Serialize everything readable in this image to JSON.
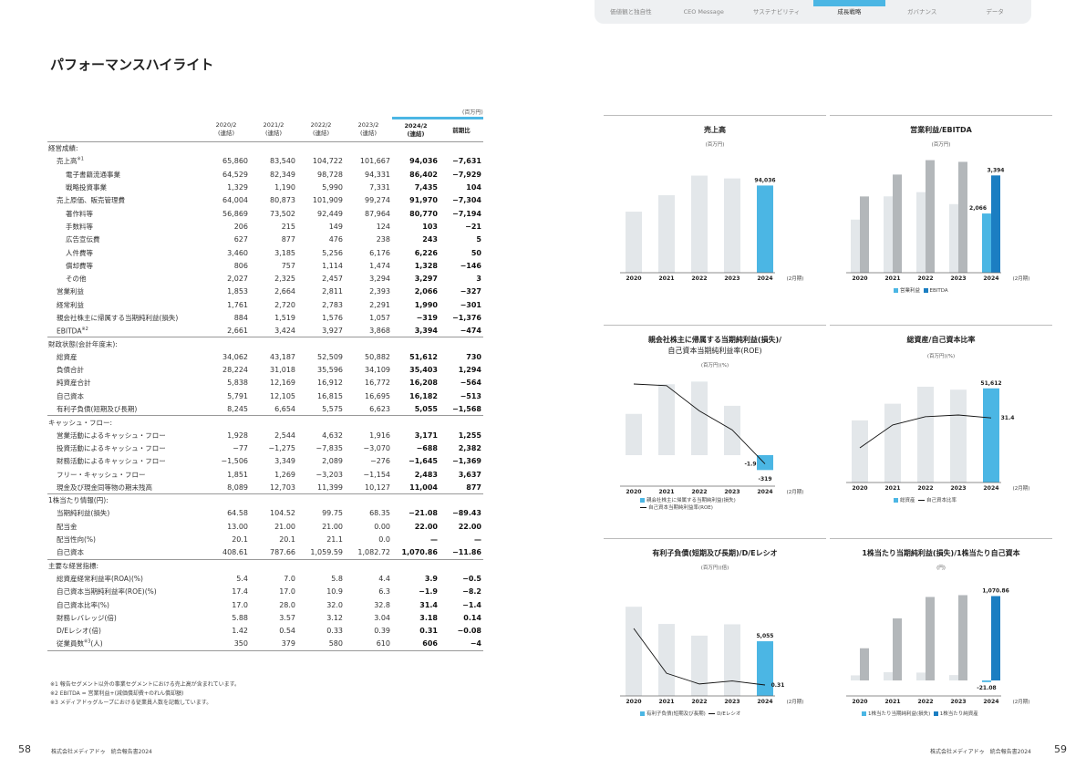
{
  "nav": {
    "tabs": [
      "価値観と独自性",
      "CEO Message",
      "サステナビリティ",
      "成長戦略",
      "ガバナンス",
      "データ"
    ],
    "active": 3
  },
  "page_title": "パフォーマンスハイライト",
  "unit": "(百万円)",
  "table": {
    "headers": [
      {
        "year": "2020/2",
        "basis": "(連結)"
      },
      {
        "year": "2021/2",
        "basis": "(連結)"
      },
      {
        "year": "2022/2",
        "basis": "(連結)"
      },
      {
        "year": "2023/2",
        "basis": "(連結)"
      },
      {
        "year": "2024/2",
        "basis": "(連結)"
      }
    ],
    "change_header": "前期比",
    "sections": [
      {
        "title": "経営成績:",
        "rows": [
          {
            "label": "売上高",
            "sup": "※1",
            "indent": 1,
            "values": [
              "65,860",
              "83,540",
              "104,722",
              "101,667",
              "94,036",
              "−7,631"
            ]
          },
          {
            "label": "電子書籍流通事業",
            "indent": 2,
            "values": [
              "64,529",
              "82,349",
              "98,728",
              "94,331",
              "86,402",
              "−7,929"
            ]
          },
          {
            "label": "戦略投資事業",
            "indent": 2,
            "values": [
              "1,329",
              "1,190",
              "5,990",
              "7,331",
              "7,435",
              "104"
            ]
          },
          {
            "label": "売上原価、販売管理費",
            "indent": 1,
            "values": [
              "64,004",
              "80,873",
              "101,909",
              "99,274",
              "91,970",
              "−7,304"
            ]
          },
          {
            "label": "著作料等",
            "indent": 2,
            "values": [
              "56,869",
              "73,502",
              "92,449",
              "87,964",
              "80,770",
              "−7,194"
            ]
          },
          {
            "label": "手数料等",
            "indent": 2,
            "values": [
              "206",
              "215",
              "149",
              "124",
              "103",
              "−21"
            ]
          },
          {
            "label": "広告宣伝費",
            "indent": 2,
            "values": [
              "627",
              "877",
              "476",
              "238",
              "243",
              "5"
            ]
          },
          {
            "label": "人件費等",
            "indent": 2,
            "values": [
              "3,460",
              "3,185",
              "5,256",
              "6,176",
              "6,226",
              "50"
            ]
          },
          {
            "label": "償却費等",
            "indent": 2,
            "values": [
              "806",
              "757",
              "1,114",
              "1,474",
              "1,328",
              "−146"
            ]
          },
          {
            "label": "その他",
            "indent": 2,
            "values": [
              "2,027",
              "2,325",
              "2,457",
              "3,294",
              "3,297",
              "3"
            ]
          },
          {
            "label": "営業利益",
            "indent": 1,
            "values": [
              "1,853",
              "2,664",
              "2,811",
              "2,393",
              "2,066",
              "−327"
            ]
          },
          {
            "label": "経常利益",
            "indent": 1,
            "values": [
              "1,761",
              "2,720",
              "2,783",
              "2,291",
              "1,990",
              "−301"
            ]
          },
          {
            "label": "親会社株主に帰属する当期純利益(損失)",
            "indent": 1,
            "values": [
              "884",
              "1,519",
              "1,576",
              "1,057",
              "−319",
              "−1,376"
            ]
          },
          {
            "label": "EBITDA",
            "sup": "※2",
            "indent": 1,
            "values": [
              "2,661",
              "3,424",
              "3,927",
              "3,868",
              "3,394",
              "−474"
            ]
          }
        ]
      },
      {
        "title": "財政状態(会計年度末):",
        "rows": [
          {
            "label": "総資産",
            "indent": 1,
            "values": [
              "34,062",
              "43,187",
              "52,509",
              "50,882",
              "51,612",
              "730"
            ]
          },
          {
            "label": "負債合計",
            "indent": 1,
            "values": [
              "28,224",
              "31,018",
              "35,596",
              "34,109",
              "35,403",
              "1,294"
            ]
          },
          {
            "label": "純資産合計",
            "indent": 1,
            "values": [
              "5,838",
              "12,169",
              "16,912",
              "16,772",
              "16,208",
              "−564"
            ]
          },
          {
            "label": "自己資本",
            "indent": 1,
            "values": [
              "5,791",
              "12,105",
              "16,815",
              "16,695",
              "16,182",
              "−513"
            ]
          },
          {
            "label": "有利子負債(短期及び長期)",
            "indent": 1,
            "values": [
              "8,245",
              "6,654",
              "5,575",
              "6,623",
              "5,055",
              "−1,568"
            ]
          }
        ]
      },
      {
        "title": "キャッシュ・フロー:",
        "rows": [
          {
            "label": "営業活動によるキャッシュ・フロー",
            "indent": 1,
            "values": [
              "1,928",
              "2,544",
              "4,632",
              "1,916",
              "3,171",
              "1,255"
            ]
          },
          {
            "label": "投資活動によるキャッシュ・フロー",
            "indent": 1,
            "values": [
              "−77",
              "−1,275",
              "−7,835",
              "−3,070",
              "−688",
              "2,382"
            ]
          },
          {
            "label": "財務活動によるキャッシュ・フロー",
            "indent": 1,
            "values": [
              "−1,506",
              "3,349",
              "2,089",
              "−276",
              "−1,645",
              "−1,369"
            ]
          },
          {
            "label": "フリー・キャッシュ・フロー",
            "indent": 1,
            "values": [
              "1,851",
              "1,269",
              "−3,203",
              "−1,154",
              "2,483",
              "3,637"
            ]
          },
          {
            "label": "現金及び現金同等物の期末残高",
            "indent": 1,
            "values": [
              "8,089",
              "12,703",
              "11,399",
              "10,127",
              "11,004",
              "877"
            ]
          }
        ]
      },
      {
        "title": "1株当たり情報(円):",
        "rows": [
          {
            "label": "当期純利益(損失)",
            "indent": 1,
            "values": [
              "64.58",
              "104.52",
              "99.75",
              "68.35",
              "−21.08",
              "−89.43"
            ]
          },
          {
            "label": "配当金",
            "indent": 1,
            "values": [
              "13.00",
              "21.00",
              "21.00",
              "0.00",
              "22.00",
              "22.00"
            ]
          },
          {
            "label": "配当性向(%)",
            "indent": 1,
            "values": [
              "20.1",
              "20.1",
              "21.1",
              "0.0",
              "—",
              "—"
            ]
          },
          {
            "label": "自己資本",
            "indent": 1,
            "values": [
              "408.61",
              "787.66",
              "1,059.59",
              "1,082.72",
              "1,070.86",
              "−11.86"
            ]
          }
        ]
      },
      {
        "title": "主要な経営指標:",
        "rows": [
          {
            "label": "総資産経常利益率(ROA)(%)",
            "indent": 1,
            "values": [
              "5.4",
              "7.0",
              "5.8",
              "4.4",
              "3.9",
              "−0.5"
            ]
          },
          {
            "label": "自己資本当期純利益率(ROE)(%)",
            "indent": 1,
            "values": [
              "17.4",
              "17.0",
              "10.9",
              "6.3",
              "−1.9",
              "−8.2"
            ]
          },
          {
            "label": "自己資本比率(%)",
            "indent": 1,
            "values": [
              "17.0",
              "28.0",
              "32.0",
              "32.8",
              "31.4",
              "−1.4"
            ]
          },
          {
            "label": "財務レバレッジ(倍)",
            "indent": 1,
            "values": [
              "5.88",
              "3.57",
              "3.12",
              "3.04",
              "3.18",
              "0.14"
            ]
          },
          {
            "label": "D/Eレシオ(倍)",
            "indent": 1,
            "values": [
              "1.42",
              "0.54",
              "0.33",
              "0.39",
              "0.31",
              "−0.08"
            ]
          },
          {
            "label": "従業員数",
            "sup": "※3",
            "suffix": "(人)",
            "indent": 1,
            "values": [
              "350",
              "379",
              "580",
              "610",
              "606",
              "−4"
            ]
          }
        ]
      }
    ]
  },
  "footnotes": [
    "※1 報告セグメント以外の事業セグメントにおける売上高が含まれています。",
    "※2 EBITDA = 営業利益+(減価償却費+のれん償却額)",
    "※3 メディアドゥグループにおける従業員人数を記載しています。"
  ],
  "footer": {
    "left_page": "58",
    "right_page": "59",
    "company": "株式会社メディアドゥ　統合報告書2024"
  },
  "colors": {
    "accent": "#4bb6e4",
    "dark_blue": "#1b7ec2",
    "bar_light": "#e3e7ea",
    "bar_gray": "#b3b7ba",
    "line": "#111111"
  },
  "chart_data": [
    {
      "type": "bar",
      "title": "売上高",
      "unit": "(百万円)",
      "categories": [
        "2020",
        "2021",
        "2022",
        "2023",
        "2024"
      ],
      "series": [
        {
          "values": [
            65860,
            83540,
            104722,
            101667,
            94036
          ]
        }
      ],
      "data_labels": {
        "4": "94,036"
      },
      "x_note": "(2月期)",
      "ylim": [
        0,
        120000
      ]
    },
    {
      "type": "bar",
      "title": "営業利益/EBITDA",
      "unit": "(百万円)",
      "categories": [
        "2020",
        "2021",
        "2022",
        "2023",
        "2024"
      ],
      "series": [
        {
          "name": "営業利益",
          "values": [
            1853,
            2664,
            2811,
            2393,
            2066
          ]
        },
        {
          "name": "EBITDA",
          "values": [
            2661,
            3424,
            3927,
            3868,
            3394
          ]
        }
      ],
      "data_labels": {
        "0": "2,066",
        "1": "3,394"
      },
      "x_note": "(2月期)",
      "ylim": [
        0,
        4200
      ]
    },
    {
      "type": "bar",
      "title": "親会社株主に帰属する当期純利益(損失)/",
      "subtitle": "自己資本当期純利益率(ROE)",
      "unit": "(百万円)(%)",
      "categories": [
        "2020",
        "2021",
        "2022",
        "2023",
        "2024"
      ],
      "series": [
        {
          "name": "親会社株主に帰属する当期純利益(損失)",
          "values": [
            884,
            1519,
            1576,
            1057,
            -319
          ]
        },
        {
          "name": "自己資本当期純利益率(ROE)",
          "values": [
            17.4,
            17.0,
            10.9,
            6.3,
            -1.9
          ]
        }
      ],
      "data_labels": {
        "0": "-319",
        "1": "-1.9"
      },
      "x_note": "(2月期)"
    },
    {
      "type": "bar",
      "title": "総資産/自己資本比率",
      "unit": "(百万円)(%)",
      "categories": [
        "2020",
        "2021",
        "2022",
        "2023",
        "2024"
      ],
      "series": [
        {
          "name": "総資産",
          "values": [
            34062,
            43187,
            52509,
            50882,
            51612
          ]
        },
        {
          "name": "自己資本比率",
          "values": [
            17.0,
            28.0,
            32.0,
            32.8,
            31.4
          ]
        }
      ],
      "data_labels": {
        "0": "51,612",
        "1": "31.4"
      },
      "x_note": "(2月期)"
    },
    {
      "type": "bar",
      "title": "有利子負債(短期及び長期)/D/Eレシオ",
      "unit": "(百万円)(倍)",
      "categories": [
        "2020",
        "2021",
        "2022",
        "2023",
        "2024"
      ],
      "series": [
        {
          "name": "有利子負債(短期及び長期)",
          "values": [
            8245,
            6654,
            5575,
            6623,
            5055
          ]
        },
        {
          "name": "D/Eレシオ",
          "values": [
            1.42,
            0.54,
            0.33,
            0.39,
            0.31
          ]
        }
      ],
      "data_labels": {
        "0": "5,055",
        "1": "0.31"
      },
      "x_note": "(2月期)"
    },
    {
      "type": "bar",
      "title": "1株当たり当期純利益(損失)/1株当たり自己資本",
      "unit": "(円)",
      "categories": [
        "2020",
        "2021",
        "2022",
        "2023",
        "2024"
      ],
      "series": [
        {
          "name": "1株当たり当期純利益(損失)",
          "values": [
            64.58,
            104.52,
            99.75,
            68.35,
            -21.08
          ]
        },
        {
          "name": "1株当たり純資産",
          "values": [
            408.61,
            787.66,
            1059.59,
            1082.72,
            1070.86
          ]
        }
      ],
      "data_labels": {
        "0": "-21.08",
        "1": "1,070.86"
      },
      "x_note": "(2月期)"
    }
  ]
}
